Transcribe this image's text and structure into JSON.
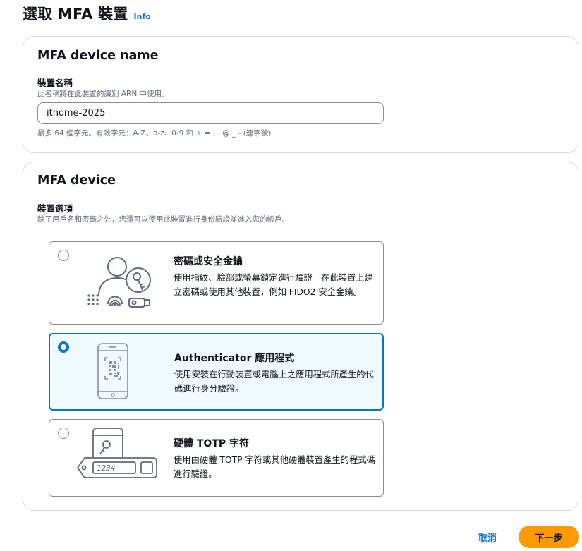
{
  "header": {
    "title": "選取 MFA 裝置",
    "info_link": "Info"
  },
  "name_panel": {
    "title": "MFA device name",
    "field_label": "裝置名稱",
    "field_description": "此名稱將在此裝置的識別 ARN 中使用。",
    "input_value": "ithome-2025",
    "constraint": "最多 64 個字元。有效字元：A-Z、a-z、0-9 和 + = , . @ _ - (連字號)"
  },
  "device_panel": {
    "title": "MFA device",
    "field_label": "裝置選項",
    "field_description": "除了用戶名和密碼之外，您還可以使用此裝置進行身份驗證並進入您的帳戶。",
    "options": [
      {
        "title": "密碼或安全金鑰",
        "description": "使用指紋、臉部或螢幕鎖定進行驗證。在此裝置上建立密碼或使用其他裝置，例如 FIDO2 安全金鑰。",
        "icon": "passkey-security-key-icon",
        "selected": false
      },
      {
        "title": "Authenticator 應用程式",
        "description": "使用安裝在行動裝置或電腦上之應用程式所產生的代碼進行身分驗證。",
        "icon": "authenticator-app-icon",
        "selected": true
      },
      {
        "title": "硬體 TOTP 字符",
        "description": "使用由硬體 TOTP 字符或其他硬體裝置產生的程式碼進行驗證。",
        "icon": "hardware-totp-token-icon",
        "token_display": "1234",
        "selected": false
      }
    ]
  },
  "footer": {
    "cancel_label": "取消",
    "next_label": "下一步"
  },
  "colors": {
    "accent": "#0972d3",
    "primary_button": "#ff9900",
    "selected_bg": "#f0fbff",
    "border": "#d5dbdb"
  }
}
